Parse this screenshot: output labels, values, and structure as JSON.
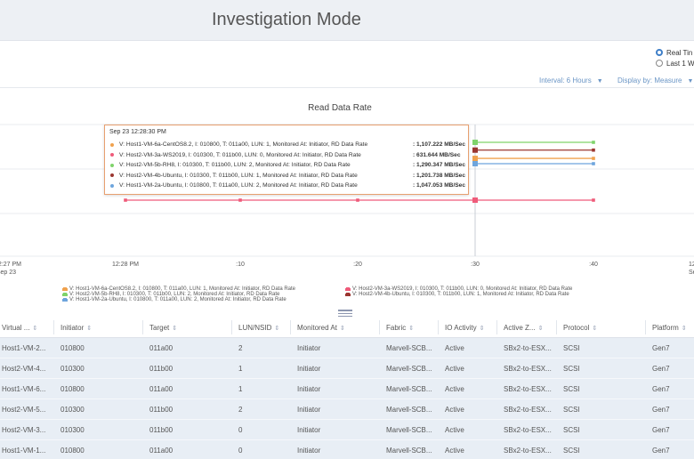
{
  "header": {
    "title": "Investigation Mode"
  },
  "mode": {
    "options": [
      {
        "label": "Real Tin",
        "selected": true
      },
      {
        "label": "Last 1 W",
        "selected": false
      }
    ]
  },
  "controls": {
    "interval_label": "Interval: 6 Hours",
    "display_label": "Display by: Measure"
  },
  "colors": {
    "orange": "#f0a24e",
    "green": "#7fd36b",
    "blue": "#6ea5dd",
    "pink": "#ef5b7a",
    "darkred": "#9b3630",
    "accent": "#3f7fc8"
  },
  "chart_data": {
    "type": "line",
    "title": "Read Data Rate",
    "x_ticks": [
      {
        "label": "12:27 PM",
        "sub": "Sep 23"
      },
      {
        "label": "12:28 PM",
        "sub": ""
      },
      {
        "label": ":10",
        "sub": ""
      },
      {
        "label": ":20",
        "sub": ""
      },
      {
        "label": ":30",
        "sub": ""
      },
      {
        "label": ":40",
        "sub": ""
      },
      {
        "label": "12:",
        "sub": "Se"
      }
    ],
    "series": [
      {
        "name": "V: Host1-VM-6a-CentOS8.2, I: 010800, T: 011a00, LUN: 1, Monitored At: Initiator, RD Data Rate",
        "color": "orange",
        "y": 1107.222,
        "points": [
          ":30",
          ":40"
        ]
      },
      {
        "name": "V: Host2-VM-3a-WS2019, I: 010300, T: 011b00, LUN: 0, Monitored At: Initiator, RD Data Rate",
        "color": "pink",
        "y": 631.644,
        "points": [
          "12:28 PM",
          ":10",
          ":20",
          ":30",
          ":40"
        ]
      },
      {
        "name": "V: Host2-VM-5b-RH8, I: 010300, T: 011b00, LUN: 2, Monitored At: Initiator, RD Data Rate",
        "color": "green",
        "y": 1290.347,
        "points": [
          ":30",
          ":40"
        ]
      },
      {
        "name": "V: Host2-VM-4b-Ubuntu, I: 010300, T: 011b00, LUN: 1, Monitored At: Initiator, RD Data Rate",
        "color": "darkred",
        "y": 1201.738,
        "points": [
          ":30",
          ":40"
        ]
      },
      {
        "name": "V: Host1-VM-2a-Ubuntu, I: 010800, T: 011a00, LUN: 2, Monitored At: Initiator, RD Data Rate",
        "color": "blue",
        "y": 1047.053,
        "points": [
          ":30",
          ":40"
        ]
      }
    ],
    "crosshair_x": ":30",
    "grid": true
  },
  "tooltip": {
    "time": "Sep 23 12:28:30 PM",
    "rows": [
      {
        "color": "orange",
        "label": "V: Host1-VM-6a-CentOS8.2, I: 010800, T: 011a00, LUN: 1, Monitored At: Initiator, RD Data Rate",
        "value": ": 1,107.222 MB/Sec"
      },
      {
        "color": "pink",
        "label": "V: Host2-VM-3a-WS2019, I: 010300, T: 011b00, LUN: 0, Monitored At: Initiator, RD Data Rate",
        "value": ": 631.644 MB/Sec"
      },
      {
        "color": "green",
        "label": "V: Host2-VM-5b-RH8, I: 010300, T: 011b00, LUN: 2, Monitored At: Initiator, RD Data Rate",
        "value": ": 1,290.347 MB/Sec"
      },
      {
        "color": "darkred",
        "label": "V: Host2-VM-4b-Ubuntu, I: 010300, T: 011b00, LUN: 1, Monitored At: Initiator, RD Data Rate",
        "value": ": 1,201.738 MB/Sec"
      },
      {
        "color": "blue",
        "label": "V: Host1-VM-2a-Ubuntu, I: 010800, T: 011a00, LUN: 2, Monitored At: Initiator, RD Data Rate",
        "value": ": 1,047.053 MB/Sec"
      }
    ]
  },
  "legend": [
    {
      "color": "orange",
      "label": "V: Host1-VM-6a-CentOS8.2, I: 010800, T: 011a00, LUN: 1, Monitored At: Initiator, RD Data Rate"
    },
    {
      "color": "pink",
      "label": "V: Host2-VM-3a-WS2019, I: 010300, T: 011b00, LUN: 0, Monitored At: Initiator, RD Data Rate"
    },
    {
      "color": "green",
      "label": "V: Host2-VM-5b-RH8, I: 010300, T: 011b00, LUN: 2, Monitored At: Initiator, RD Data Rate"
    },
    {
      "color": "darkred",
      "label": "V: Host2-VM-4b-Ubuntu, I: 010300, T: 011b00, LUN: 1, Monitored At: Initiator, RD Data Rate"
    },
    {
      "color": "blue",
      "label": "V: Host1-VM-2a-Ubuntu, I: 010800, T: 011a00, LUN: 2, Monitored At: Initiator, RD Data Rate"
    }
  ],
  "table": {
    "columns": [
      "Virtual ...",
      "Initiator",
      "Target",
      "LUN/NSID",
      "Monitored At",
      "Fabric",
      "IO Activity",
      "Active Z...",
      "Protocol",
      "Platform"
    ],
    "rows": [
      [
        "Host1-VM-2...",
        "010800",
        "011a00",
        "2",
        "Initiator",
        "Marvell-SCB...",
        "Active",
        "SBx2-to-ESX...",
        "SCSI",
        "Gen7"
      ],
      [
        "Host2-VM-4...",
        "010300",
        "011b00",
        "1",
        "Initiator",
        "Marvell-SCB...",
        "Active",
        "SBx2-to-ESX...",
        "SCSI",
        "Gen7"
      ],
      [
        "Host1-VM-6...",
        "010800",
        "011a00",
        "1",
        "Initiator",
        "Marvell-SCB...",
        "Active",
        "SBx2-to-ESX...",
        "SCSI",
        "Gen7"
      ],
      [
        "Host2-VM-5...",
        "010300",
        "011b00",
        "2",
        "Initiator",
        "Marvell-SCB...",
        "Active",
        "SBx2-to-ESX...",
        "SCSI",
        "Gen7"
      ],
      [
        "Host2-VM-3...",
        "010300",
        "011b00",
        "0",
        "Initiator",
        "Marvell-SCB...",
        "Active",
        "SBx2-to-ESX...",
        "SCSI",
        "Gen7"
      ],
      [
        "Host1-VM-1...",
        "010800",
        "011a00",
        "0",
        "Initiator",
        "Marvell-SCB...",
        "Active",
        "SBx2-to-ESX...",
        "SCSI",
        "Gen7"
      ]
    ]
  }
}
